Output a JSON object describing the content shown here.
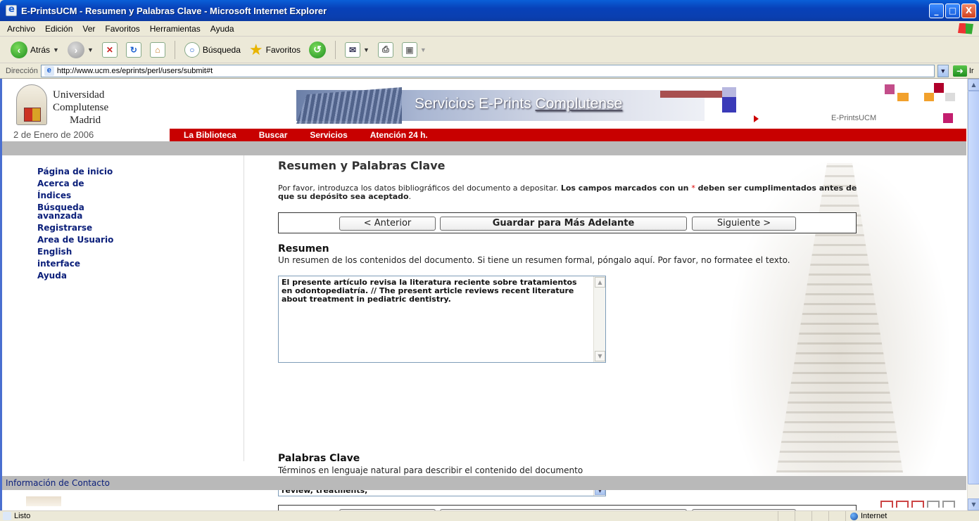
{
  "window": {
    "title": "E-PrintsUCM - Resumen y Palabras Clave - Microsoft Internet Explorer",
    "controls": [
      "_",
      "□",
      "X"
    ]
  },
  "menu": [
    "Archivo",
    "Edición",
    "Ver",
    "Favoritos",
    "Herramientas",
    "Ayuda"
  ],
  "toolbar": {
    "back": "Atrás",
    "search": "Búsqueda",
    "favorites": "Favoritos"
  },
  "address": {
    "label": "Dirección",
    "url": "http://www.ucm.es/eprints/perl/users/submit#t",
    "go": "Ir"
  },
  "header": {
    "uni_line1": "Universidad",
    "uni_line2": "Complutense",
    "uni_line3": "Madrid",
    "banner_prefix": "Servicios E-Prints ",
    "banner_underlined": "Complutense",
    "eprints_label": "E-PrintsUCM",
    "date": "2 de Enero de 2006",
    "nav": [
      "La Biblioteca",
      "Buscar",
      "Servicios",
      "Atención 24 h."
    ]
  },
  "sidebar": {
    "items": [
      "Página de inicio",
      "Acerca de",
      "Índices",
      "Búsqueda avanzada",
      "Registrarse",
      "Area de Usuario",
      "English interface",
      "Ayuda"
    ]
  },
  "main": {
    "title": "Resumen y Palabras Clave",
    "intro_plain": "Por favor, introduzca los datos bibliográficos del documento a depositar. ",
    "intro_bold1": "Los campos marcados con un ",
    "intro_star": "*",
    "intro_bold2": " deben ser cumplimentados antes de que su depósito sea aceptado",
    "intro_end": ".",
    "buttons": {
      "prev": "< Anterior",
      "save": "Guardar para Más Adelante",
      "next": "Siguiente >"
    },
    "resumen": {
      "heading": "Resumen",
      "help": "Un resumen de los contenidos del documento. Si tiene un resumen formal, póngalo aquí. Por favor, no formatee el texto.",
      "value": "El presente artículo revisa la literatura reciente sobre tratamientos en odontopediatría. // The present article reviews recent literature about treatment in pediatric dentistry."
    },
    "palabras": {
      "heading": "Palabras Clave",
      "help": "Términos en lenguaje natural para describir el contenido del documento",
      "value": "Revisión bibliográfica, tratamientos, odontopediatría // Bibliographic review, treatments,"
    }
  },
  "footer": {
    "contact": "Información de Contacto"
  },
  "status": {
    "left": "Listo",
    "zone": "Internet"
  },
  "colors": {
    "nav_red": "#c80000",
    "link_blue": "#0b1f7a",
    "title_blue": "#0a3fb0"
  }
}
